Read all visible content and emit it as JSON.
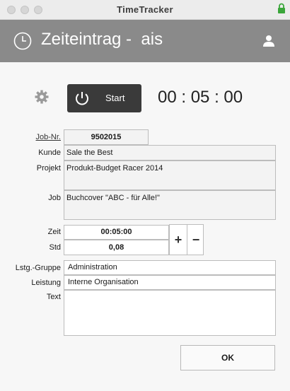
{
  "window": {
    "title": "TimeTracker"
  },
  "header": {
    "title": "Zeiteintrag -  ais"
  },
  "timer": {
    "start_label": "Start",
    "display": "00 : 05 : 00"
  },
  "form": {
    "job_nr_label": "Job-Nr.",
    "job_nr_value": "9502015",
    "kunde_label": "Kunde",
    "kunde_value": "Sale the Best",
    "projekt_label": "Projekt",
    "projekt_value": "Produkt-Budget Racer 2014",
    "job_label": "Job",
    "job_value": "Buchcover \"ABC -  für Alle!\"",
    "zeit_label": "Zeit",
    "zeit_value": "00:05:00",
    "std_label": "Std",
    "std_value": "0,08",
    "plus": "+",
    "minus": "−",
    "lstg_label": "Lstg.-Gruppe",
    "lstg_value": "Administration",
    "leistung_label": "Leistung",
    "leistung_value": "Interne Organisation",
    "text_label": "Text",
    "text_value": ""
  },
  "ok_label": "OK",
  "colors": {
    "header_bg": "#8a8a8a",
    "start_bg": "#3a3a3a",
    "lock": "#3aa63a"
  }
}
